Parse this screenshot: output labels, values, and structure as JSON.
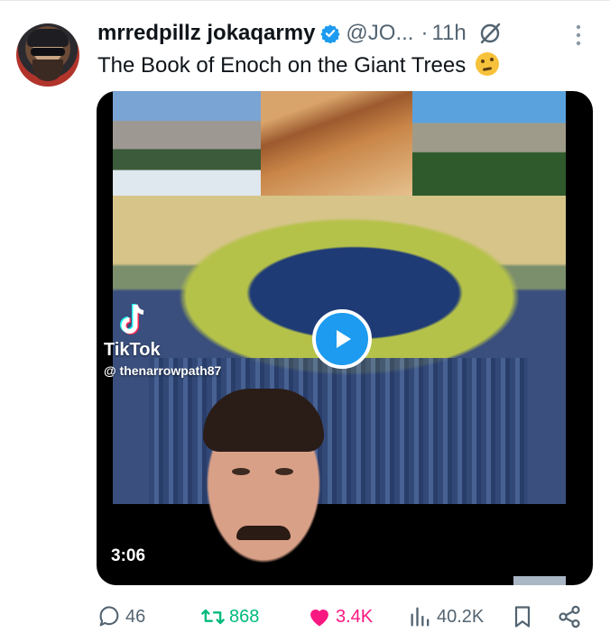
{
  "author": {
    "display_name": "mrredpillz jokaqarmy",
    "handle": "@JO...",
    "separator": "·",
    "time": "11h",
    "verified_color": "#1d9bf0"
  },
  "tweet": {
    "text": "The Book of Enoch on the Giant Trees",
    "emoji": "thinking-face-emoji"
  },
  "media": {
    "watermark_brand": "TikTok",
    "watermark_user": "@ thenarrowpath87",
    "duration": "3:06",
    "play_color": "#1d9bf0"
  },
  "actions": {
    "replies": "46",
    "retweets": "868",
    "likes": "3.4K",
    "views": "40.2K",
    "reply_color": "#536471",
    "retweet_color": "#00ba7c",
    "like_color": "#f91880"
  }
}
